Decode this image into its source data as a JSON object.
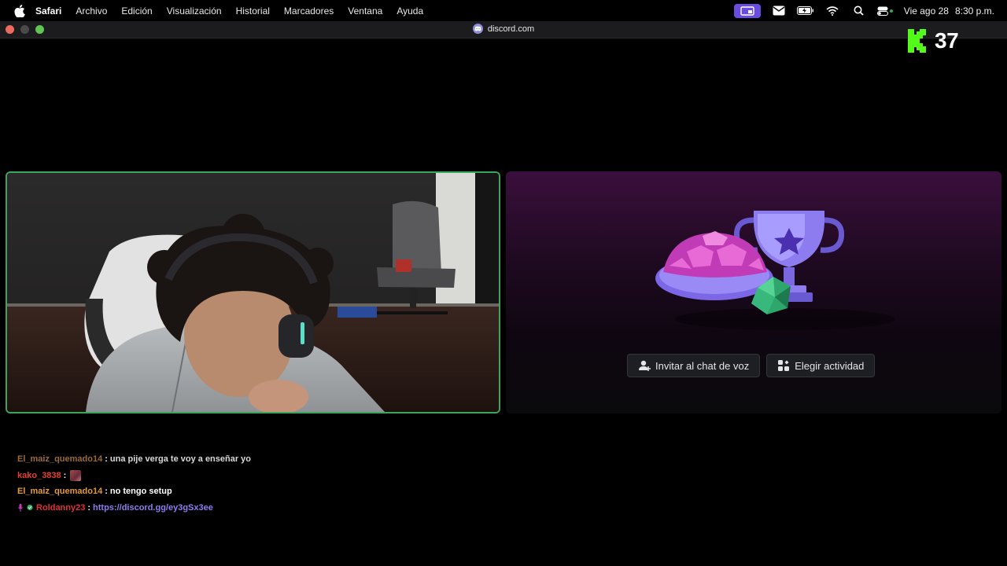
{
  "menubar": {
    "app": "Safari",
    "items": [
      "Archivo",
      "Edición",
      "Visualización",
      "Historial",
      "Marcadores",
      "Ventana",
      "Ayuda"
    ],
    "date": "Vie ago 28",
    "time": "8:30 p.m."
  },
  "browser": {
    "url": "discord.com"
  },
  "kick": {
    "viewer_count": "37"
  },
  "activity": {
    "invite_label": "Invitar al chat de voz",
    "choose_label": "Elegir actividad"
  },
  "chat": {
    "messages": [
      {
        "user": "El_maiz_quemado14",
        "user_color": "#9b6a38",
        "text": "una pije verga te voy a enseñar yo"
      },
      {
        "user": "kako_3838",
        "user_color": "#e0402f",
        "text": ""
      },
      {
        "user": "El_maiz_quemado14",
        "user_color": "#e39a35",
        "text": "no tengo setup"
      },
      {
        "user": "Roldanny23",
        "user_color": "#e0303a",
        "text": "https://discord.gg/ey3gSx3ee"
      }
    ]
  },
  "colors": {
    "speaking_border": "#3ba55d",
    "link": "#8f7cf0",
    "kick_green": "#53fc18"
  }
}
